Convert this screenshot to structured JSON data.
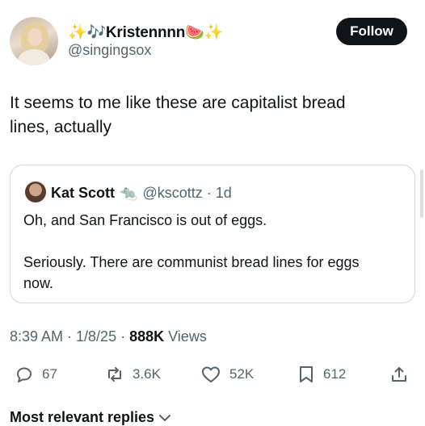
{
  "author": {
    "display_name": "✨🎶Kristennnn🍉✨",
    "handle": "@singingsox"
  },
  "follow_label": "Follow",
  "tweet_text": "It seems to me like these are capitalist bread\nlines, actually",
  "quoted_tweet": {
    "name": "Kat Scott",
    "emoji": "🐀",
    "meta": "@kscottz · 1d",
    "text": "Oh, and San Francisco is out of eggs.\n\nSeriously. There are communist bread lines for eggs\nnow."
  },
  "timestamp": {
    "time_date": "8:39 AM · 1/8/25 · ",
    "views_count": "888K",
    "views_label": "Views"
  },
  "actions": {
    "replies": "67",
    "reposts": "3.6K",
    "likes": "52K",
    "bookmarks": "612"
  },
  "replies_sort_label": "Most relevant replies",
  "icons": {
    "reply": "reply-icon",
    "repost": "repost-icon",
    "like": "heart-icon",
    "bookmark": "bookmark-icon",
    "share": "share-icon",
    "chevron": "chevron-down-icon"
  },
  "colors": {
    "text": "#0f1419",
    "secondary": "#536471",
    "border": "#cfd9de",
    "button_bg": "#0f1419"
  }
}
